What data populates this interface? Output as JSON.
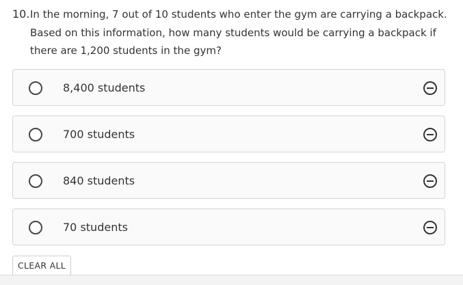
{
  "question": {
    "number": "10.",
    "text": "In the morning, 7 out of 10 students who enter the gym are carrying a backpack. Based on this information, how many students would be carrying a backpack if there are 1,200 students in the gym?"
  },
  "choices": [
    {
      "label": "8,400 students",
      "selected": false,
      "eliminated": false
    },
    {
      "label": "700 students",
      "selected": false,
      "eliminated": false
    },
    {
      "label": "840 students",
      "selected": false,
      "eliminated": false
    },
    {
      "label": "70 students",
      "selected": false,
      "eliminated": false
    }
  ],
  "actions": {
    "clear_all_label": "CLEAR ALL"
  },
  "icons": {
    "radio": "radio-button-icon",
    "eliminate": "eliminate-choice-icon"
  },
  "colors": {
    "text": "#333333",
    "choice_border": "#d4d4d4",
    "choice_background": "#fafafa"
  }
}
